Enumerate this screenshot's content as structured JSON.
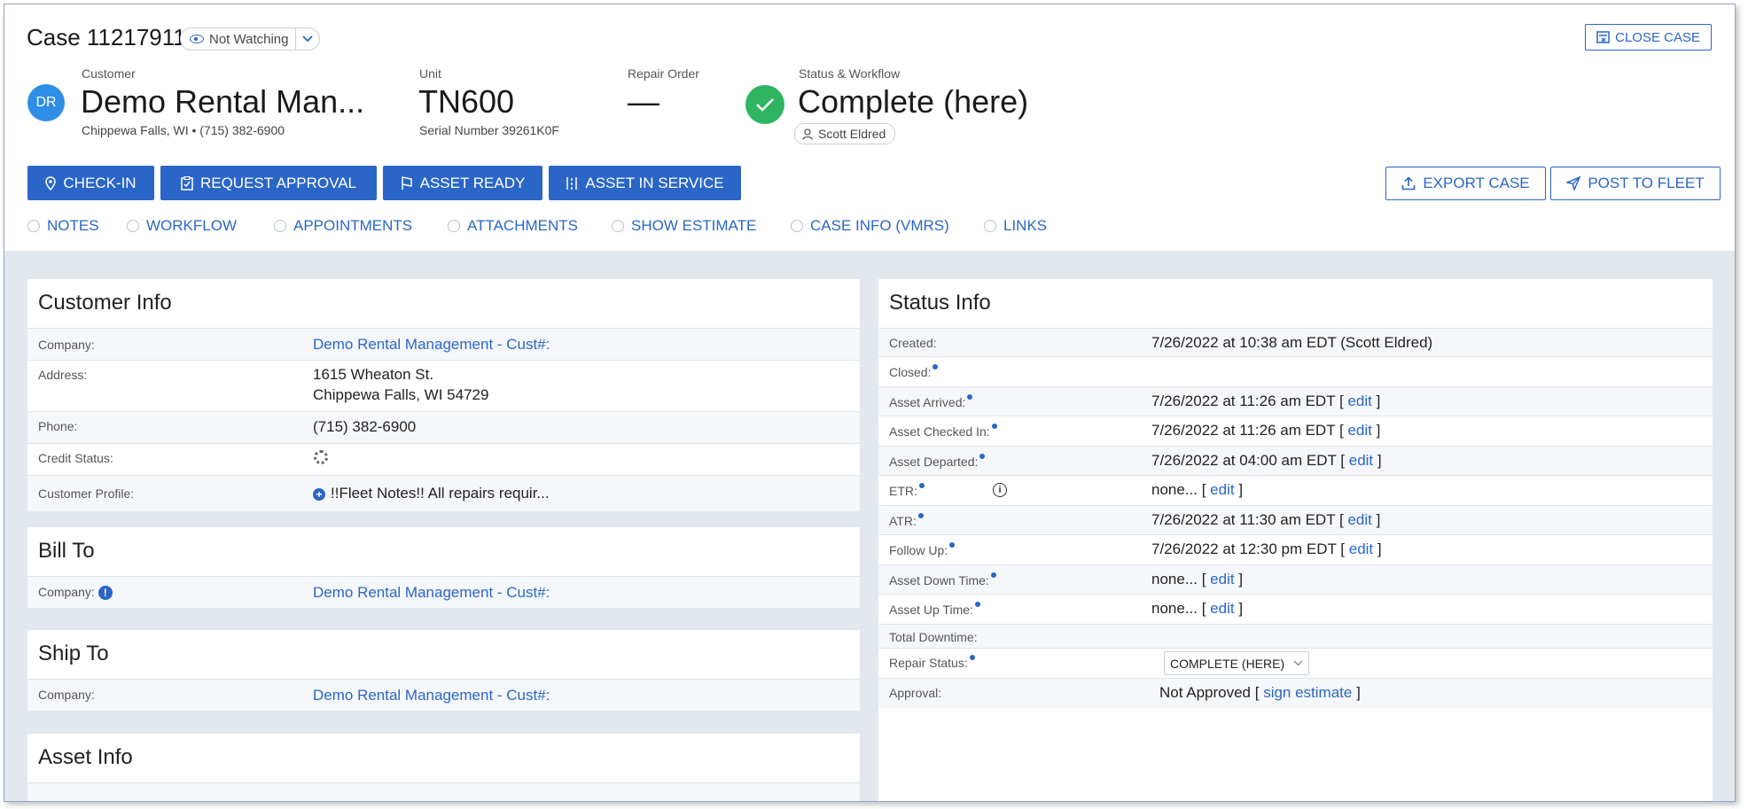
{
  "case": {
    "title": "Case 11217911",
    "watch_label": "Not Watching",
    "close_label": "CLOSE CASE"
  },
  "summary": {
    "customer_label": "Customer",
    "avatar_initials": "DR",
    "customer_name": "Demo Rental Man...",
    "customer_location": "Chippewa Falls, WI • (715) 382-6900",
    "unit_label": "Unit",
    "unit_value": "TN600",
    "serial": "Serial Number 39261K0F",
    "repair_order_label": "Repair Order",
    "repair_order_value": "—",
    "status_label": "Status & Workflow",
    "status_value": "Complete (here)",
    "assignee": "Scott Eldred"
  },
  "actions": {
    "check_in": "CHECK-IN",
    "request_approval": "REQUEST APPROVAL",
    "asset_ready": "ASSET READY",
    "asset_in_service": "ASSET IN SERVICE",
    "export_case": "EXPORT CASE",
    "post_to_fleet": "POST TO FLEET"
  },
  "toggles": [
    "NOTES",
    "WORKFLOW",
    "APPOINTMENTS",
    "ATTACHMENTS",
    "SHOW ESTIMATE",
    "CASE INFO (VMRS)",
    "LINKS"
  ],
  "customer_info": {
    "title": "Customer Info",
    "company_label": "Company:",
    "company_value": "Demo Rental Management - Cust#:",
    "address_label": "Address:",
    "address_line1": "1615 Wheaton St.",
    "address_line2": "Chippewa Falls, WI 54729",
    "phone_label": "Phone:",
    "phone_value": "(715) 382-6900",
    "credit_label": "Credit Status:",
    "profile_label": "Customer Profile:",
    "profile_value": "!!Fleet Notes!! All repairs requir..."
  },
  "bill_to": {
    "title": "Bill To",
    "company_label": "Company:",
    "company_value": "Demo Rental Management - Cust#:"
  },
  "ship_to": {
    "title": "Ship To",
    "company_label": "Company:",
    "company_value": "Demo Rental Management - Cust#:"
  },
  "asset_info": {
    "title": "Asset Info"
  },
  "status_info": {
    "title": "Status Info",
    "edit": "edit",
    "rows": [
      {
        "label": "Created:",
        "value": "7/26/2022 at 10:38 am EDT (Scott Eldred)"
      },
      {
        "label": "Closed:",
        "value": ""
      },
      {
        "label": "Asset Arrived:",
        "value": "7/26/2022 at 11:26 am EDT"
      },
      {
        "label": "Asset Checked In:",
        "value": "7/26/2022 at 11:26 am EDT"
      },
      {
        "label": "Asset Departed:",
        "value": "7/26/2022 at 04:00 am EDT"
      },
      {
        "label": "ETR:",
        "value": "none..."
      },
      {
        "label": "ATR:",
        "value": "7/26/2022 at 11:30 am EDT"
      },
      {
        "label": "Follow Up:",
        "value": "7/26/2022 at 12:30 pm EDT"
      },
      {
        "label": "Asset Down Time:",
        "value": "none..."
      },
      {
        "label": "Asset Up Time:",
        "value": "none..."
      },
      {
        "label": "Total Downtime:",
        "value": ""
      },
      {
        "label": "Repair Status:",
        "value": "COMPLETE (HERE)"
      },
      {
        "label": "Approval:",
        "value": "Not Approved",
        "link": "sign estimate"
      }
    ]
  }
}
